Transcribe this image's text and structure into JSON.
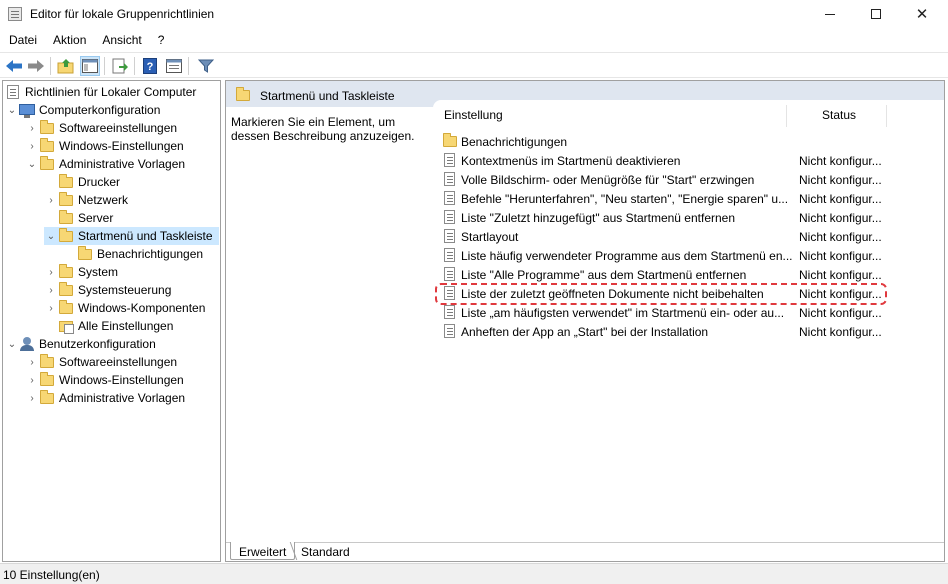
{
  "window": {
    "title": "Editor für lokale Gruppenrichtlinien",
    "minimize_glyph": "—",
    "maximize_glyph": "☐",
    "close_glyph": "✕"
  },
  "menu": [
    "Datei",
    "Aktion",
    "Ansicht",
    "?"
  ],
  "toolbar": {
    "buttons": [
      "back-icon",
      "forward-icon",
      "up-folder-icon",
      "show-hide-tree-icon",
      "export-list-icon",
      "help-icon",
      "properties-icon",
      "filter-icon"
    ],
    "colors": {
      "arrow": "#2b74c6",
      "active_bg": "#cce4f7"
    }
  },
  "tree": [
    {
      "label": "Richtlinien für Lokaler Computer",
      "icon": "doc-icon",
      "expander": ""
    },
    {
      "label": "Computerkonfiguration",
      "icon": "computer-icon",
      "expander": "expanded"
    },
    {
      "label": "Softwareeinstellungen",
      "icon": "folder-icon",
      "expander": "collapsed"
    },
    {
      "label": "Windows-Einstellungen",
      "icon": "folder-icon",
      "expander": "collapsed"
    },
    {
      "label": "Administrative Vorlagen",
      "icon": "folder-icon",
      "expander": "expanded"
    },
    {
      "label": "Drucker",
      "icon": "folder-icon",
      "expander": ""
    },
    {
      "label": "Netzwerk",
      "icon": "folder-icon",
      "expander": "collapsed"
    },
    {
      "label": "Server",
      "icon": "folder-icon",
      "expander": ""
    },
    {
      "label": "Startmenü und Taskleiste",
      "icon": "folder-icon",
      "expander": "expanded",
      "selected": true
    },
    {
      "label": "Benachrichtigungen",
      "icon": "folder-icon",
      "expander": ""
    },
    {
      "label": "System",
      "icon": "folder-icon",
      "expander": "collapsed"
    },
    {
      "label": "Systemsteuerung",
      "icon": "folder-icon",
      "expander": "collapsed"
    },
    {
      "label": "Windows-Komponenten",
      "icon": "folder-icon",
      "expander": "collapsed"
    },
    {
      "label": "Alle Einstellungen",
      "icon": "settings-icon",
      "expander": ""
    },
    {
      "label": "Benutzerkonfiguration",
      "icon": "user-icon",
      "expander": "expanded"
    },
    {
      "label": "Softwareeinstellungen",
      "icon": "folder-icon",
      "expander": "collapsed"
    },
    {
      "label": "Windows-Einstellungen",
      "icon": "folder-icon",
      "expander": "collapsed"
    },
    {
      "label": "Administrative Vorlagen",
      "icon": "folder-icon",
      "expander": "collapsed"
    }
  ],
  "right_pane": {
    "header_title": "Startmenü und Taskleiste",
    "description": "Markieren Sie ein Element, um dessen Beschreibung anzuzeigen.",
    "columns": {
      "setting": "Einstellung",
      "status": "Status"
    },
    "rows": [
      {
        "name": "Benachrichtigungen",
        "status": "",
        "icon": "folder-icon"
      },
      {
        "name": "Kontextmenüs im Startmenü deaktivieren",
        "status": "Nicht konfigur...",
        "icon": "policy-icon"
      },
      {
        "name": "Volle Bildschirm- oder Menügröße für \"Start\" erzwingen",
        "status": "Nicht konfigur...",
        "icon": "policy-icon"
      },
      {
        "name": "Befehle \"Herunterfahren\", \"Neu starten\", \"Energie sparen\" u...",
        "status": "Nicht konfigur...",
        "icon": "policy-icon"
      },
      {
        "name": "Liste \"Zuletzt hinzugefügt\" aus Startmenü entfernen",
        "status": "Nicht konfigur...",
        "icon": "policy-icon"
      },
      {
        "name": "Startlayout",
        "status": "Nicht konfigur...",
        "icon": "policy-icon"
      },
      {
        "name": "Liste häufig verwendeter Programme aus dem Startmenü en...",
        "status": "Nicht konfigur...",
        "icon": "policy-icon"
      },
      {
        "name": "Liste \"Alle Programme\" aus dem Startmenü entfernen",
        "status": "Nicht konfigur...",
        "icon": "policy-icon"
      },
      {
        "name": "Liste der zuletzt geöffneten Dokumente nicht beibehalten",
        "status": "Nicht konfigur...",
        "icon": "policy-icon",
        "highlighted": true
      },
      {
        "name": "Liste „am häufigsten verwendet\" im Startmenü ein- oder au...",
        "status": "Nicht konfigur...",
        "icon": "policy-icon"
      },
      {
        "name": "Anheften der App an „Start\" bei der Installation",
        "status": "Nicht konfigur...",
        "icon": "policy-icon"
      }
    ],
    "highlight_color": "#e0393e"
  },
  "tabs": [
    "Erweitert",
    "Standard"
  ],
  "statusbar": {
    "text": "10 Einstellung(en)"
  }
}
